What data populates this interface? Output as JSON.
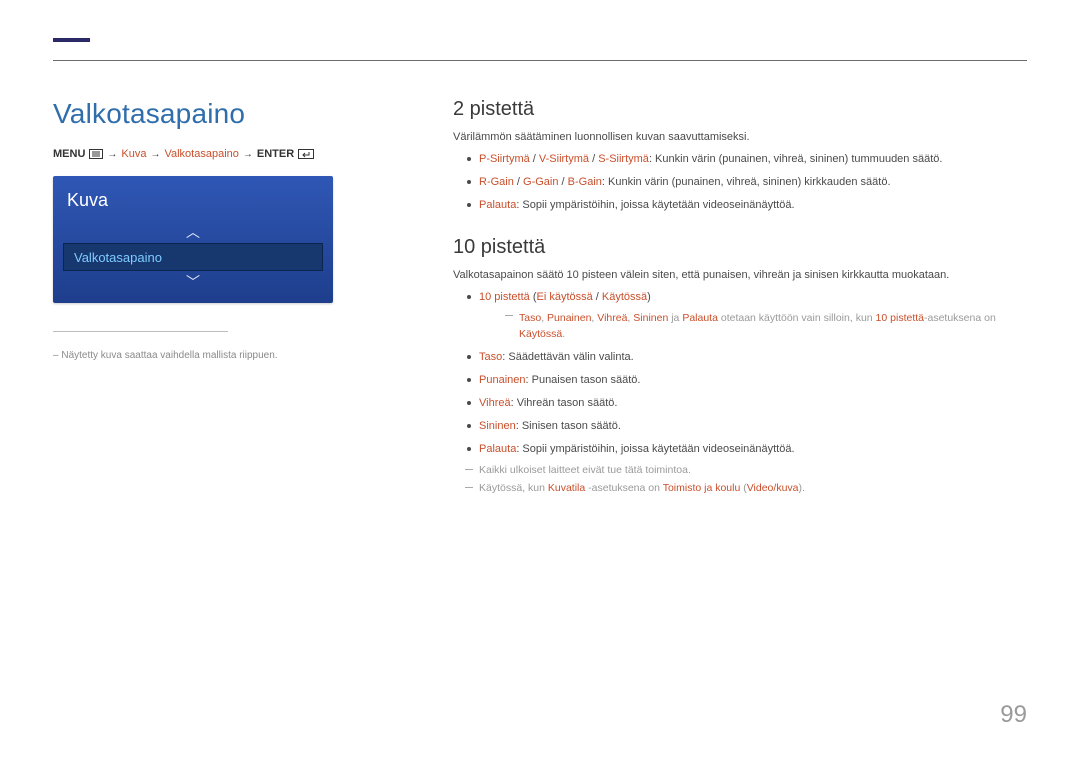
{
  "title": "Valkotasapaino",
  "breadcrumb": {
    "menu": "MENU",
    "p1": "Kuva",
    "p2": "Valkotasapaino",
    "enter": "ENTER"
  },
  "menubox": {
    "title": "Kuva",
    "selected": "Valkotasapaino"
  },
  "caption_prefix": "– ",
  "caption": "Näytetty kuva saattaa vaihdella mallista riippuen.",
  "sect1": {
    "heading": "2 pistettä",
    "lead": "Värilämmön säätäminen luonnollisen kuvan saavuttamiseksi.",
    "b1_a": "P-Siirtymä",
    "b1_s1": " / ",
    "b1_b": "V-Siirtymä",
    "b1_s2": " / ",
    "b1_c": "S-Siirtymä",
    "b1_t": ": Kunkin värin (punainen, vihreä, sininen) tummuuden säätö.",
    "b2_a": "R-Gain",
    "b2_s1": " / ",
    "b2_b": "G-Gain",
    "b2_s2": " / ",
    "b2_c": "B-Gain",
    "b2_t": ": Kunkin värin (punainen, vihreä, sininen) kirkkauden säätö.",
    "b3_a": "Palauta",
    "b3_t": ": Sopii ympäristöihin, joissa käytetään videoseinänäyttöä."
  },
  "sect2": {
    "heading": "10 pistettä",
    "lead": "Valkotasapainon säätö 10 pisteen välein siten, että punaisen, vihreän ja sinisen kirkkautta muokataan.",
    "b1_a": "10 pistettä",
    "b1_p1": " (",
    "b1_b": "Ei käytössä",
    "b1_s1": " / ",
    "b1_c": "Käytössä",
    "b1_p2": ")",
    "sub1_a": "Taso",
    "sub1_s1": ", ",
    "sub1_b": "Punainen",
    "sub1_s2": ", ",
    "sub1_c": "Vihreä",
    "sub1_s3": ", ",
    "sub1_d": "Sininen",
    "sub1_t1": " ja ",
    "sub1_e": "Palauta",
    "sub1_t2": " otetaan käyttöön vain silloin, kun ",
    "sub1_f": "10 pistettä",
    "sub1_t3": "-asetuksena on ",
    "sub1_g": "Käytössä",
    "sub1_t4": ".",
    "b2_a": "Taso",
    "b2_t": ": Säädettävän välin valinta.",
    "b3_a": "Punainen",
    "b3_t": ": Punaisen tason säätö.",
    "b4_a": "Vihreä",
    "b4_t": ": Vihreän tason säätö.",
    "b5_a": "Sininen",
    "b5_t": ": Sinisen tason säätö.",
    "b6_a": "Palauta",
    "b6_t": ": Sopii ympäristöihin, joissa käytetään videoseinänäyttöä.",
    "sub2": "Kaikki ulkoiset laitteet eivät tue tätä toimintoa.",
    "sub3_t1": "Käytössä, kun ",
    "sub3_a": "Kuvatila",
    "sub3_t2": " -asetuksena on ",
    "sub3_b": "Toimisto ja koulu",
    "sub3_t3": " (",
    "sub3_c": "Video/kuva",
    "sub3_t4": ")."
  },
  "page_number": "99"
}
